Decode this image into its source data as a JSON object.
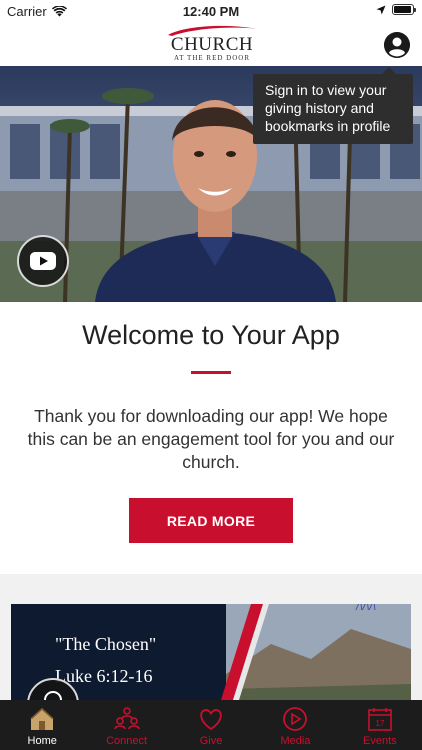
{
  "status_bar": {
    "carrier": "Carrier",
    "time": "12:40 PM",
    "battery_level": 0.95
  },
  "header": {
    "logo_main": "CHURCH",
    "logo_sub": "AT THE RED DOOR",
    "profile_icon": "user-circle-icon"
  },
  "tooltip": {
    "text": "Sign in to view your giving history and bookmarks in profile"
  },
  "hero": {
    "play_icon": "youtube-icon"
  },
  "welcome": {
    "title": "Welcome to Your App",
    "body": "Thank you for downloading our app! We hope this can be an engagement tool for you and our church.",
    "button_label": "READ MORE"
  },
  "sermon": {
    "line1": "\"The Chosen\"",
    "line2": "Luke 6:12-16"
  },
  "tabs": [
    {
      "label": "Home",
      "icon": "home-icon",
      "active": true
    },
    {
      "label": "Connect",
      "icon": "people-icon",
      "active": false
    },
    {
      "label": "Give",
      "icon": "heart-icon",
      "active": false
    },
    {
      "label": "Media",
      "icon": "play-circle-icon",
      "active": false
    },
    {
      "label": "Events",
      "icon": "calendar-icon",
      "active": false
    }
  ],
  "colors": {
    "accent": "#c8102e",
    "tab_bar": "#1c1c1c",
    "tooltip": "#2e2e2e"
  }
}
